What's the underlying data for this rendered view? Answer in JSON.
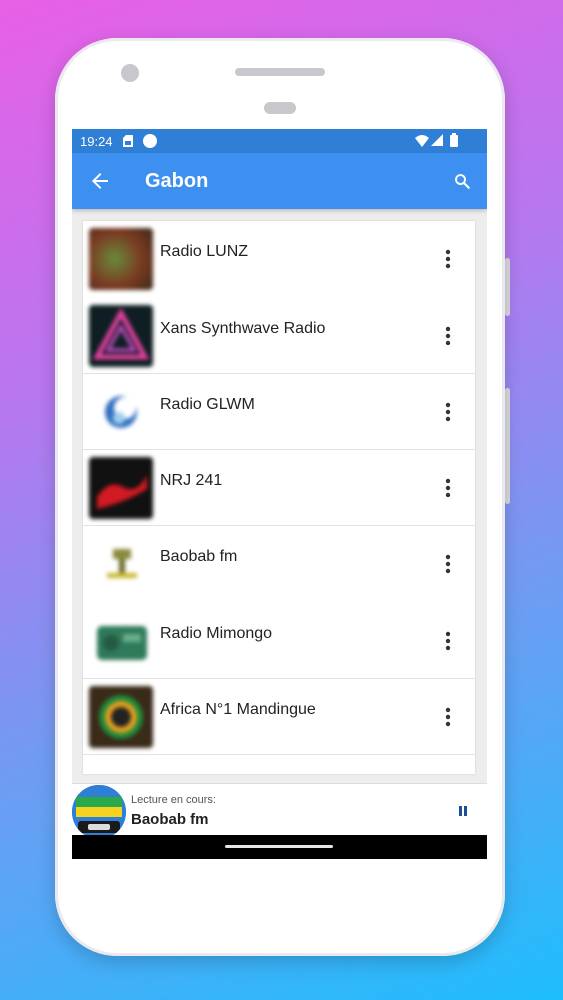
{
  "status_bar": {
    "time": "19:24",
    "left_icons": [
      "sim-card-icon",
      "circle-notification-icon"
    ],
    "right_icons": [
      "wifi-icon",
      "cell-signal-icon",
      "battery-icon"
    ]
  },
  "app_bar": {
    "title": "Gabon",
    "back_icon": "arrow-back-icon",
    "search_icon": "search-icon",
    "color": "#3d8ff0"
  },
  "stations": [
    {
      "name": "Radio LUNZ"
    },
    {
      "name": "Xans Synthwave Radio"
    },
    {
      "name": "Radio GLWM"
    },
    {
      "name": "NRJ 241"
    },
    {
      "name": "Baobab fm"
    },
    {
      "name": "Radio Mimongo"
    },
    {
      "name": "Africa N°1 Mandingue"
    }
  ],
  "now_playing": {
    "label": "Lecture en cours:",
    "station": "Baobab fm",
    "control_icon": "pause-icon"
  }
}
